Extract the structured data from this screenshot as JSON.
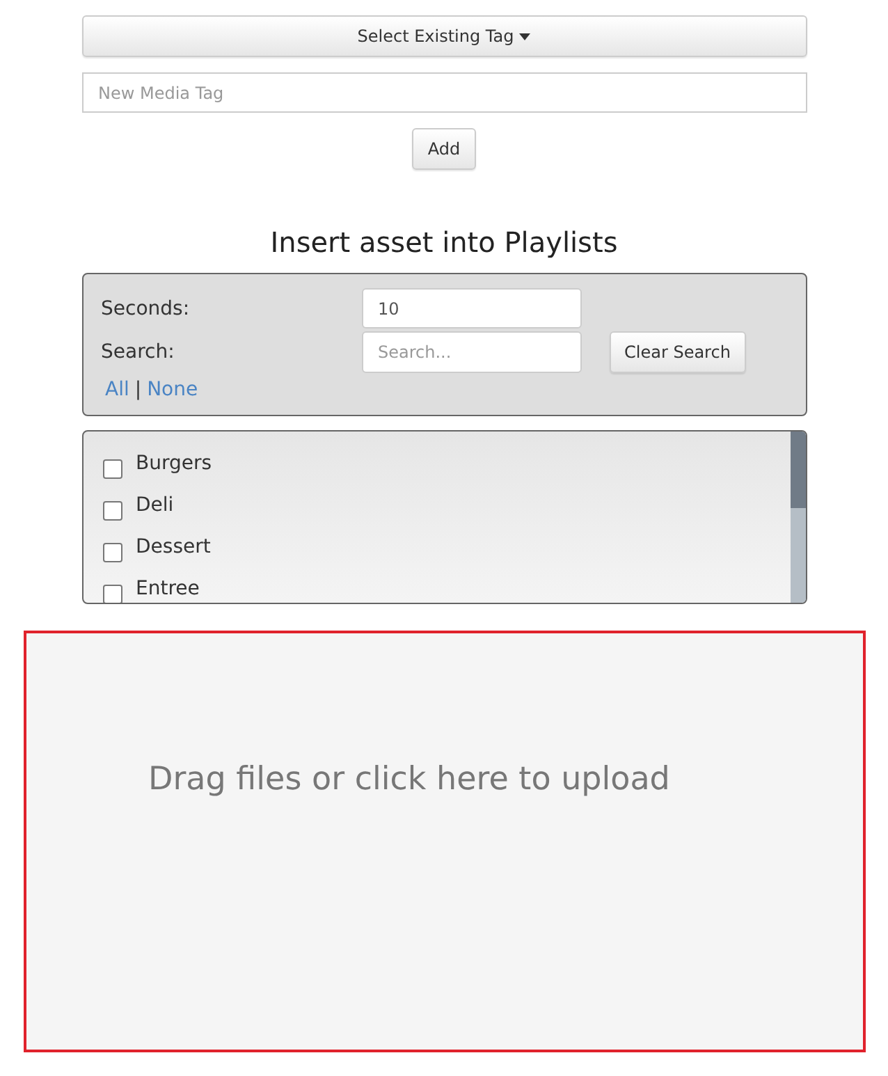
{
  "tag_dropdown": {
    "label": "Select Existing Tag"
  },
  "new_tag": {
    "placeholder": "New Media Tag"
  },
  "add_button": {
    "label": "Add"
  },
  "playlists": {
    "title": "Insert asset into Playlists",
    "filters": {
      "seconds_label": "Seconds:",
      "seconds_value": "10",
      "search_label": "Search:",
      "search_placeholder": "Search...",
      "clear_button": "Clear Search",
      "all_link": "All",
      "separator": "|",
      "none_link": "None"
    },
    "items": [
      {
        "label": "Burgers",
        "checked": false
      },
      {
        "label": "Deli",
        "checked": false
      },
      {
        "label": "Dessert",
        "checked": false
      },
      {
        "label": "Entree",
        "checked": false
      }
    ]
  },
  "dropzone": {
    "text": "Drag files or click here to upload"
  }
}
